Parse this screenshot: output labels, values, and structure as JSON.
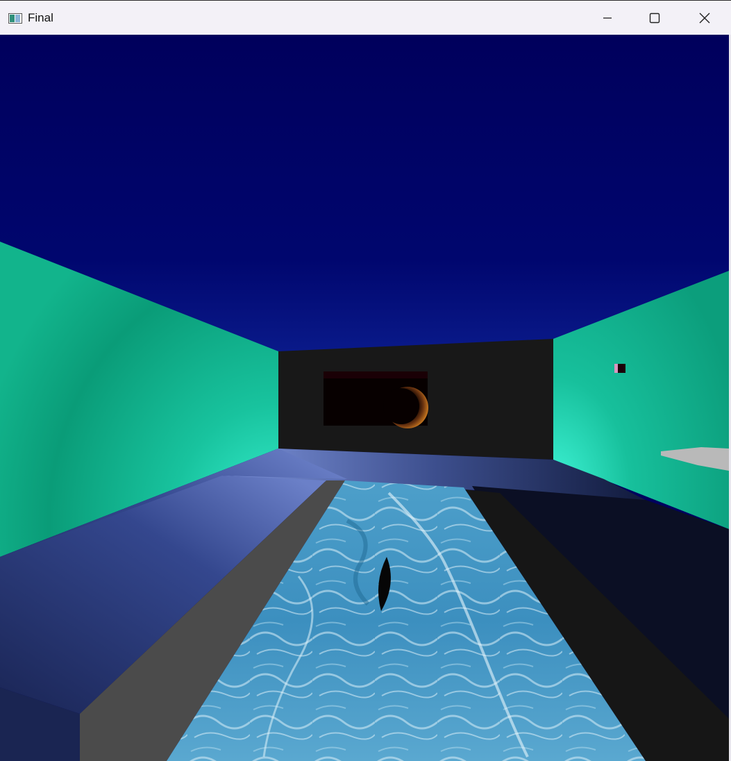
{
  "window": {
    "title": "Final",
    "icon": "app-window-icon",
    "controls": {
      "minimize_icon": "minimize-icon",
      "maximize_icon": "maximize-icon",
      "close_icon": "close-icon"
    }
  },
  "scene": {
    "ceiling_color": "#00005e",
    "wall_color": "#12b78c",
    "back_wall_color": "#181818",
    "floor_color": "#1c2a5e",
    "water_color": "#4fa0c8",
    "road_color": "#4a4a4a"
  }
}
